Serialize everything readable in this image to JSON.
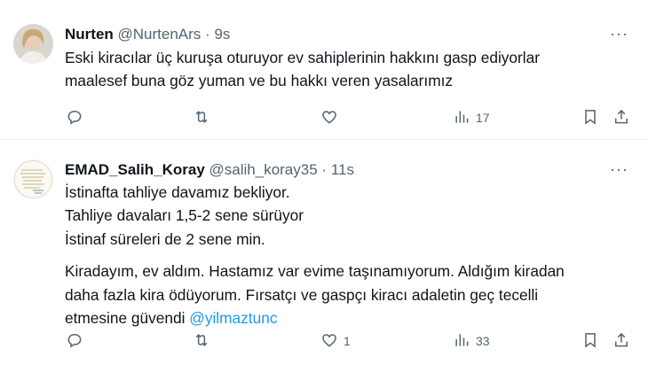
{
  "tweets": [
    {
      "name": "Nurten",
      "handle": "@NurtenArs",
      "separator": "·",
      "time": "9s",
      "lines": [
        "Eski kiracılar üç kuruşa oturuyor ev sahiplerinin hakkını gasp ediyorlar",
        "maalesef buna göz yuman ve bu hakkı veren yasalarımız"
      ],
      "counts": {
        "reply": "",
        "retweet": "",
        "like": "",
        "views": "17"
      }
    },
    {
      "name": "EMAD_Salih_Koray",
      "handle": "@salih_koray35",
      "separator": "·",
      "time": "11s",
      "lines": [
        "İstinafta tahliye davamız bekliyor.",
        "Tahliye davaları 1,5-2 sene sürüyor",
        "İstinaf süreleri de 2 sene min."
      ],
      "lines2": [
        "Kiradayım, ev aldım. Hastamız var evime taşınamıyorum. Aldığım kiradan",
        "daha fazla kira ödüyorum. Fırsatçı ve gaspçı kiracı adaletin geç tecelli",
        "etmesine güvendi"
      ],
      "mention": "@yilmaztunc",
      "counts": {
        "reply": "",
        "retweet": "",
        "like": "1",
        "views": "33"
      }
    }
  ],
  "more_label": "···",
  "icons": [
    "reply-icon",
    "retweet-icon",
    "like-icon",
    "views-icon",
    "bookmark-icon",
    "share-icon"
  ],
  "colors": {
    "text": "#0f1419",
    "secondary": "#536471",
    "link": "#1d9bf0",
    "divider": "#eff3f4"
  }
}
